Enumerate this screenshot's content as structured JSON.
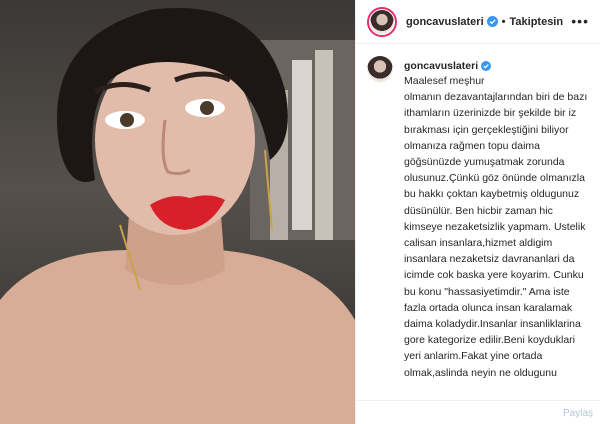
{
  "header": {
    "username": "goncavuslateri",
    "separator": "•",
    "follow_label": "Takiptesin",
    "more_label": "•••"
  },
  "caption": {
    "username": "goncavuslateri",
    "text": "Maalesef meşhur\nolmanın dezavantajlarından biri de bazı\nithamların üzerinizde bir şekilde bir iz\nbırakması için gerçekleştiğini biliyor\nolmanıza rağmen topu daima\ngöğsünüzde yumuşatmak zorunda\nolusunuz.Çünkü göz önünde olmanızla\nbu hakkı çoktan kaybetmiş oldugunuz\ndüsünülür. Ben hicbir zaman hic\nkimseye nezaketsizlik yapmam. Ustelik\ncalisan insanlara,hizmet aldigim\ninsanlara nezaketsiz davrananlari da\nicimde cok baska yere koyarim. Cunku\nbu konu \"hassasiyetimdir.\" Ama iste\nfazla ortada olunca insan karalamak\ndaima koladydir.Insanlar insanliklarina\ngore kategorize edilir.Beni koyduklari\nyeri anlarim.Fakat yine ortada\nolmak,aslinda neyin ne oldugunu"
  },
  "footer": {
    "share_label": "Paylaş"
  },
  "icons": {
    "verified": "verified-badge-icon",
    "more": "more-options-icon"
  },
  "colors": {
    "verified_blue": "#3897f0",
    "story_ring": "#e1306c",
    "lip_red": "#d8202a"
  }
}
